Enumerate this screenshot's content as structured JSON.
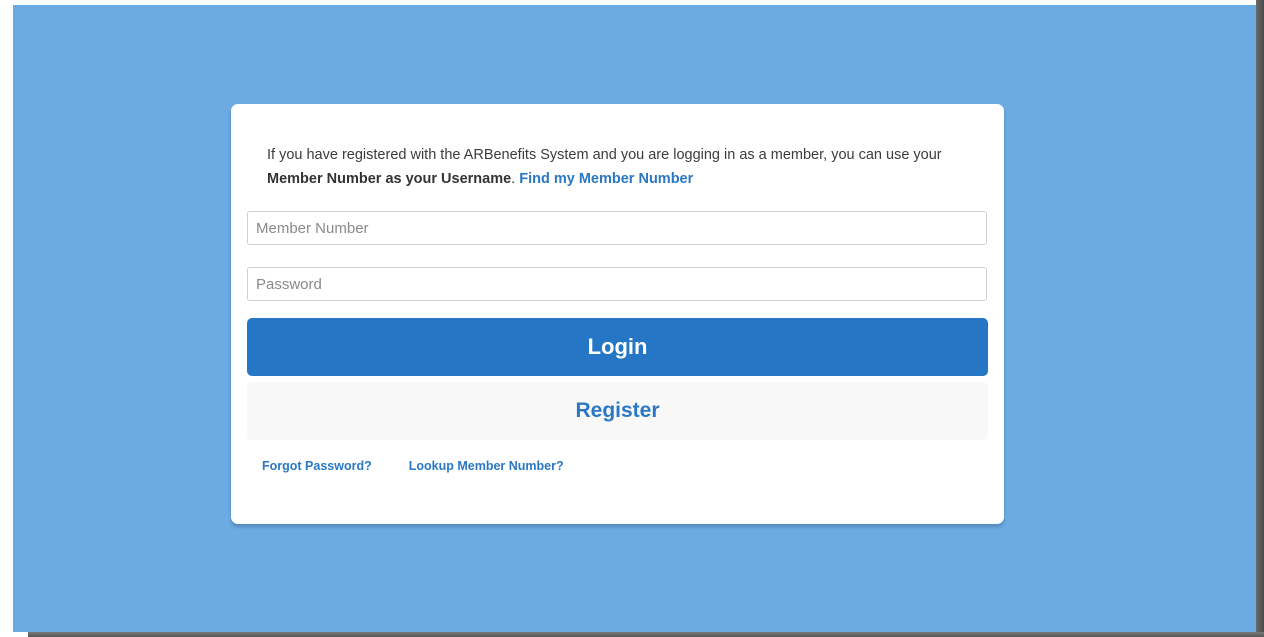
{
  "login_card": {
    "intro": {
      "text_part1": "If you have registered with the ARBenefits System and you are logging in as a member, you can use your ",
      "bold_text": "Member Number as your Username",
      "text_part2": ". ",
      "link_label": "Find my Member Number"
    },
    "member_number": {
      "placeholder": "Member Number",
      "value": ""
    },
    "password": {
      "placeholder": "Password",
      "value": ""
    },
    "login_label": "Login",
    "register_label": "Register",
    "forgot_password_label": "Forgot Password?",
    "lookup_member_label": "Lookup Member Number?"
  },
  "colors": {
    "page_background": "#6caae2",
    "primary_button": "#2576c4",
    "link": "#2a78c4",
    "secondary_button": "#f8f8f8"
  }
}
